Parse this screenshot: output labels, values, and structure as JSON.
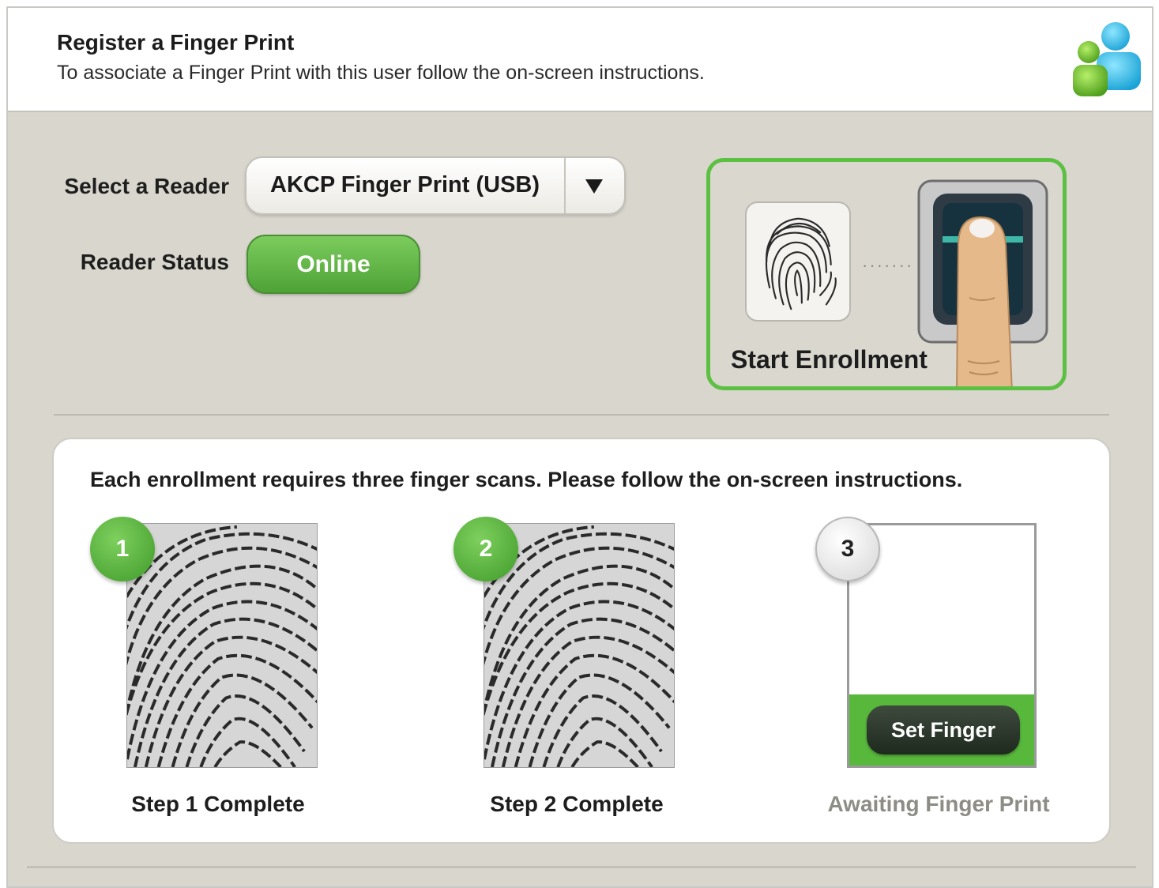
{
  "header": {
    "title": "Register a Finger Print",
    "subtitle": "To associate a Finger Print with this user follow the on-screen instructions."
  },
  "reader": {
    "select_label": "Select a Reader",
    "selected_value": "AKCP Finger Print (USB)",
    "status_label": "Reader Status",
    "status_value": "Online"
  },
  "enrollment": {
    "start_label": "Start Enrollment"
  },
  "steps": {
    "instructions": "Each enrollment requires three finger scans. Please follow the on-screen instructions.",
    "items": [
      {
        "number": "1",
        "caption": "Step 1 Complete",
        "state": "complete"
      },
      {
        "number": "2",
        "caption": "Step 2 Complete",
        "state": "complete"
      },
      {
        "number": "3",
        "caption": "Awaiting Finger Print",
        "state": "awaiting",
        "button_label": "Set Finger"
      }
    ]
  },
  "icons": {
    "header": "users-icon",
    "dropdown": "triangle-down-icon",
    "enroll_print": "fingerprint-icon",
    "enroll_scanner": "finger-scanner-icon"
  },
  "colors": {
    "accent_green": "#5cc142",
    "panel_background": "#d9d6cd",
    "awaiting_text": "#8d8c86",
    "button_dark": "#2a342a"
  }
}
